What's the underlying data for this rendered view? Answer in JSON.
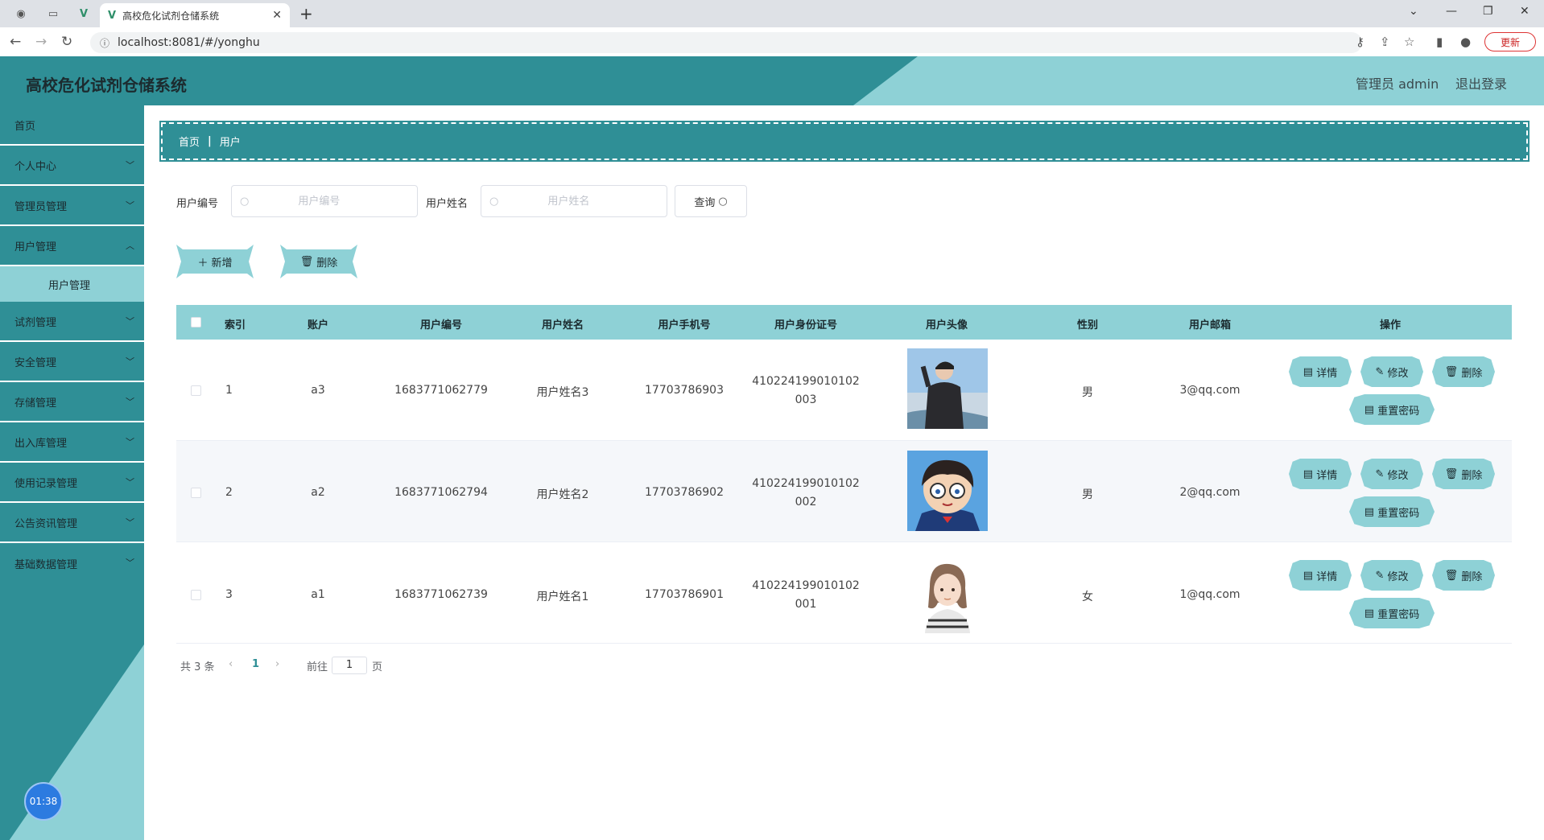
{
  "browser": {
    "tab_title": "高校危化试剂仓储系统",
    "url": "localhost:8081/#/yonghu",
    "update_label": "更新"
  },
  "header": {
    "title": "高校危化试剂仓储系统",
    "admin_label": "管理员 admin",
    "logout_label": "退出登录"
  },
  "sidebar": {
    "items": [
      {
        "label": "首页"
      },
      {
        "label": "个人中心"
      },
      {
        "label": "管理员管理"
      },
      {
        "label": "用户管理"
      },
      {
        "label": "试剂管理"
      },
      {
        "label": "安全管理"
      },
      {
        "label": "存储管理"
      },
      {
        "label": "出入库管理"
      },
      {
        "label": "使用记录管理"
      },
      {
        "label": "公告资讯管理"
      },
      {
        "label": "基础数据管理"
      }
    ],
    "sub_item": "用户管理",
    "timer": "01:38"
  },
  "breadcrumb": {
    "home": "首页",
    "current": "用户"
  },
  "search": {
    "code_label": "用户编号",
    "code_placeholder": "用户编号",
    "name_label": "用户姓名",
    "name_placeholder": "用户姓名",
    "query_label": "查询"
  },
  "actions": {
    "add_label": "新增",
    "delete_label": "删除"
  },
  "table": {
    "headers": [
      "索引",
      "账户",
      "用户编号",
      "用户姓名",
      "用户手机号",
      "用户身份证号",
      "用户头像",
      "性别",
      "用户邮箱",
      "操作"
    ],
    "rows": [
      {
        "index": "1",
        "account": "a3",
        "code": "1683771062779",
        "name": "用户姓名3",
        "phone": "17703786903",
        "id_line1": "410224199010102",
        "id_line2": "003",
        "gender": "男",
        "email": "3@qq.com"
      },
      {
        "index": "2",
        "account": "a2",
        "code": "1683771062794",
        "name": "用户姓名2",
        "phone": "17703786902",
        "id_line1": "410224199010102",
        "id_line2": "002",
        "gender": "男",
        "email": "2@qq.com"
      },
      {
        "index": "3",
        "account": "a1",
        "code": "1683771062739",
        "name": "用户姓名1",
        "phone": "17703786901",
        "id_line1": "410224199010102",
        "id_line2": "001",
        "gender": "女",
        "email": "1@qq.com"
      }
    ],
    "ops": {
      "detail": "详情",
      "edit": "修改",
      "delete": "删除",
      "reset": "重置密码"
    }
  },
  "pagination": {
    "total": "共 3 条",
    "current": "1",
    "goto": "前往",
    "page_value": "1",
    "page_unit": "页"
  }
}
